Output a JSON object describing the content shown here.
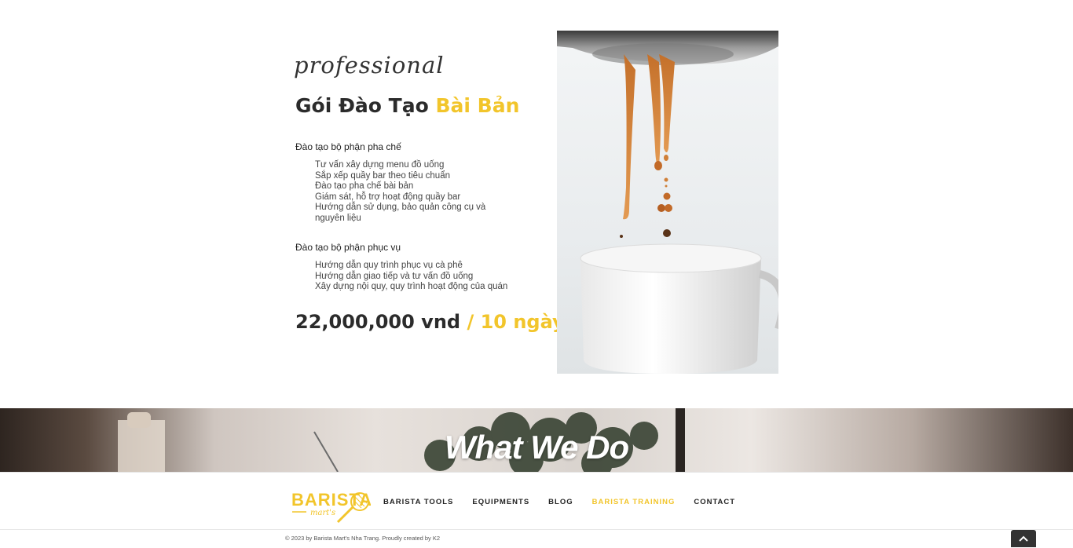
{
  "package": {
    "script_word": "professional",
    "title_main": "Gói Đào Tạo",
    "title_accent": "Bài Bản",
    "groups": [
      {
        "heading": "Đào tạo bộ phận pha chế",
        "items": [
          "Tư vấn xây dựng menu đồ uống",
          "Sắp xếp quầy bar theo tiêu chuẩn",
          "Đào tạo pha chế bài bản",
          "Giám sát, hỗ trợ hoạt động quầy bar",
          "Hướng dẫn sử dụng, bảo quản công cụ và nguyên liệu"
        ]
      },
      {
        "heading": "Đào tạo bộ phận phục vụ",
        "items": [
          "Hướng dẫn quy trình phục vụ cà phê",
          "Hướng dẫn giao tiếp và tư vấn đồ uống",
          "Xây dựng nội quy, quy trình hoạt động của quán"
        ]
      }
    ],
    "price": "22,000,000 vnd",
    "price_separator": "/",
    "duration": "10 ngày",
    "image_icon": "espresso-pour-photo"
  },
  "banner": {
    "heading": "What We Do"
  },
  "footer": {
    "logo_text": "BARISTA",
    "logo_subtext": "mart's",
    "nav": [
      {
        "label": "BARISTA TOOLS",
        "active": false
      },
      {
        "label": "EQUIPMENTS",
        "active": false
      },
      {
        "label": "BLOG",
        "active": false
      },
      {
        "label": "BARISTA TRAINING",
        "active": true
      },
      {
        "label": "CONTACT",
        "active": false
      }
    ],
    "copyright": "© 2023 by Barista Mart's Nha Trang. Proudly created by K2",
    "to_top_icon": "chevron-up-icon"
  },
  "colors": {
    "accent": "#f2c52b",
    "text_dark": "#2b2b2b"
  }
}
